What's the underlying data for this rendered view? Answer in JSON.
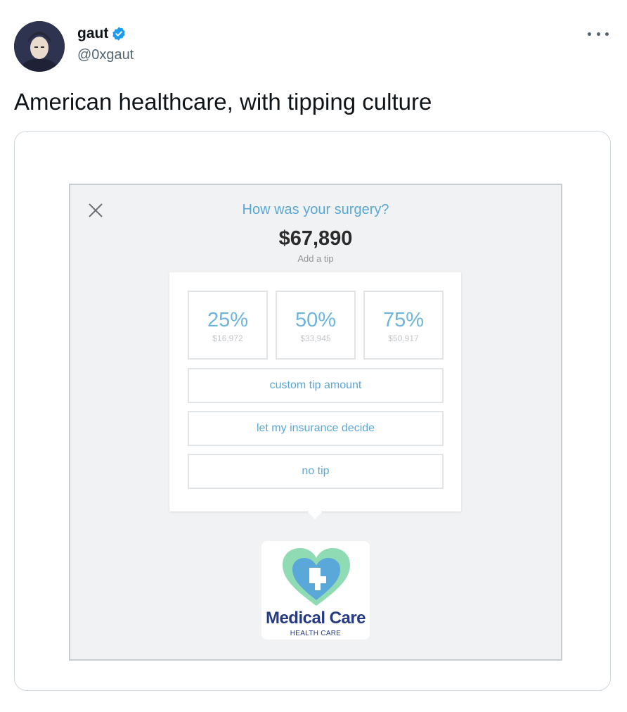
{
  "tweet": {
    "author": {
      "name": "gaut",
      "handle": "@0xgaut",
      "verified": true
    },
    "text": "American healthcare, with tipping culture",
    "icons": {
      "verified": "verified-badge-icon",
      "more": "more-options-icon"
    },
    "colors": {
      "verified": "#1d9bf0",
      "handle": "#536471"
    }
  },
  "media": {
    "question": "How was your surgery?",
    "amount": "$67,890",
    "add_tip_label": "Add a tip",
    "tip_options": [
      {
        "percent": "25%",
        "value": "$16,972"
      },
      {
        "percent": "50%",
        "value": "$33,945"
      },
      {
        "percent": "75%",
        "value": "$50,917"
      }
    ],
    "buttons": {
      "custom": "custom tip amount",
      "insurance": "let my insurance decide",
      "no_tip": "no tip"
    },
    "logo": {
      "title": "Medical Care",
      "subtitle": "HEALTH CARE"
    },
    "colors": {
      "accent": "#5aa7d5",
      "logo_navy": "#253a80",
      "heart_green": "#8fdcb4",
      "heart_blue": "#5aa7d9"
    }
  }
}
